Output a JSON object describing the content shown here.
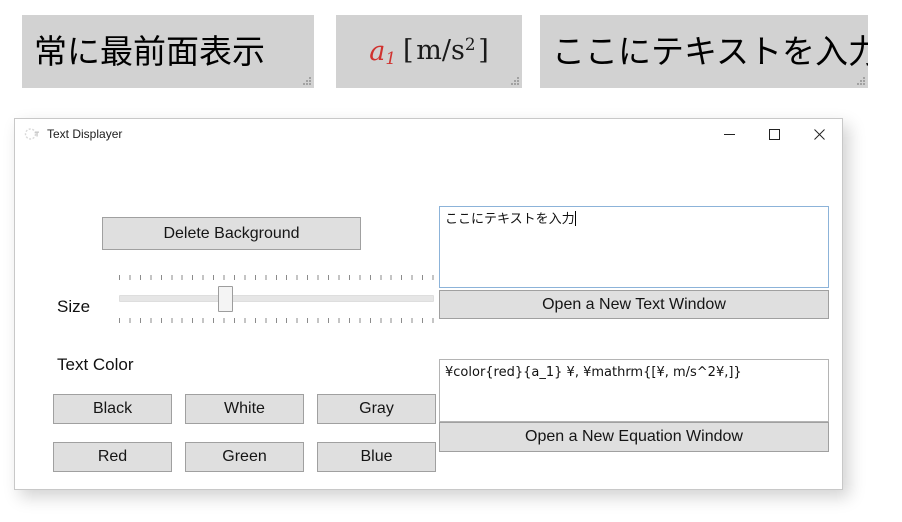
{
  "overlays": [
    {
      "id": "always-on-top",
      "name": "overlay-always-on-top",
      "text": "常に最前面表示",
      "background": "#d2d2d2",
      "color": "#000000"
    },
    {
      "id": "equation-preview",
      "name": "overlay-equation",
      "text": "a1 [ m/s2 ]",
      "variable": "a",
      "subscript": "1",
      "variable_color": "#d0322f",
      "unit_open": "[",
      "unit_body": "m/s",
      "unit_exponent": "2",
      "unit_close": "]",
      "background": "#d2d2d2"
    },
    {
      "id": "sample-text",
      "name": "overlay-sample-text",
      "text": "ここにテキストを入力",
      "background": "#d2d2d2",
      "color": "#000000"
    }
  ],
  "window": {
    "title": "Text Displayer",
    "icon": "app-feather-icon",
    "controls": {
      "minimize": "Minimize",
      "maximize": "Maximize",
      "close": "Close"
    }
  },
  "left_panel": {
    "delete_background_label": "Delete Background",
    "size_label": "Size",
    "size_slider": {
      "value": 33,
      "min": 0,
      "max": 100,
      "tick_count": 31
    },
    "text_color_label": "Text Color",
    "color_buttons": [
      {
        "label": "Black",
        "value": "#000000"
      },
      {
        "label": "White",
        "value": "#ffffff"
      },
      {
        "label": "Gray",
        "value": "#808080"
      },
      {
        "label": "Red",
        "value": "#ff0000"
      },
      {
        "label": "Green",
        "value": "#008000"
      },
      {
        "label": "Blue",
        "value": "#0000ff"
      }
    ]
  },
  "right_panel": {
    "text_input": {
      "value": "ここにテキストを入力",
      "placeholder": "",
      "focused": true
    },
    "open_text_window_label": "Open a New Text Window",
    "equation_input": {
      "value": "¥color{red}{a_1} ¥, ¥mathrm{[¥, m/s^2¥,]}",
      "placeholder": "",
      "focused": false
    },
    "open_equation_window_label": "Open a New Equation Window"
  },
  "colors": {
    "button_face": "#dfdfdf",
    "button_border": "#a0a0a0",
    "overlay_background": "#d2d2d2",
    "focus_border": "#8cb3d9",
    "field_border": "#b4b4b4",
    "accent_red": "#d0322f"
  }
}
